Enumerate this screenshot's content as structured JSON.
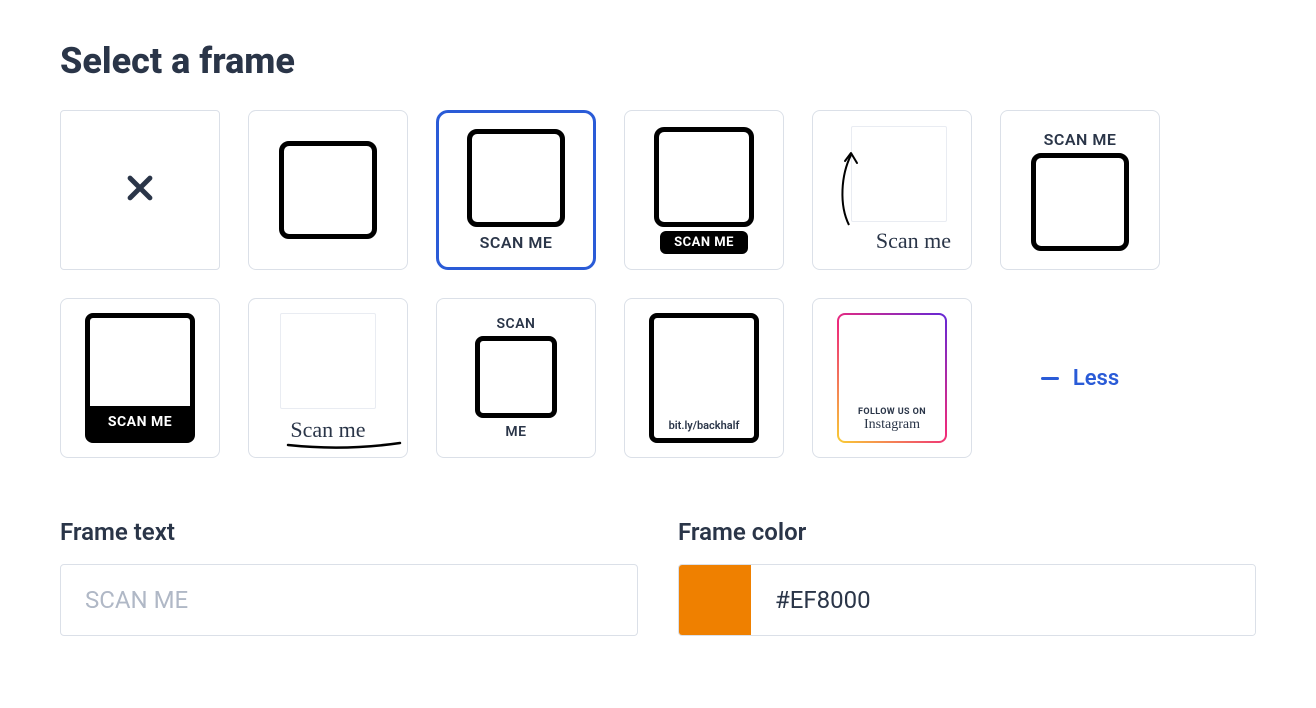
{
  "heading": "Select a frame",
  "frames": {
    "scan_me": "SCAN ME",
    "scan_me_badge": "SCAN ME",
    "scan_me_script": "Scan me",
    "scan_me_above": "SCAN ME",
    "scan_me_polaroid": "SCAN ME",
    "scan_me_script_under": "Scan me",
    "scan_top": "SCAN",
    "me_bot": "ME",
    "backhalf": "bit.ly/backhalf",
    "insta_follow": "FOLLOW US ON",
    "insta_name": "Instagram"
  },
  "less_label": "Less",
  "controls": {
    "frame_text_label": "Frame text",
    "frame_text_placeholder": "SCAN ME",
    "frame_color_label": "Frame color",
    "frame_color_value": "#EF8000"
  }
}
